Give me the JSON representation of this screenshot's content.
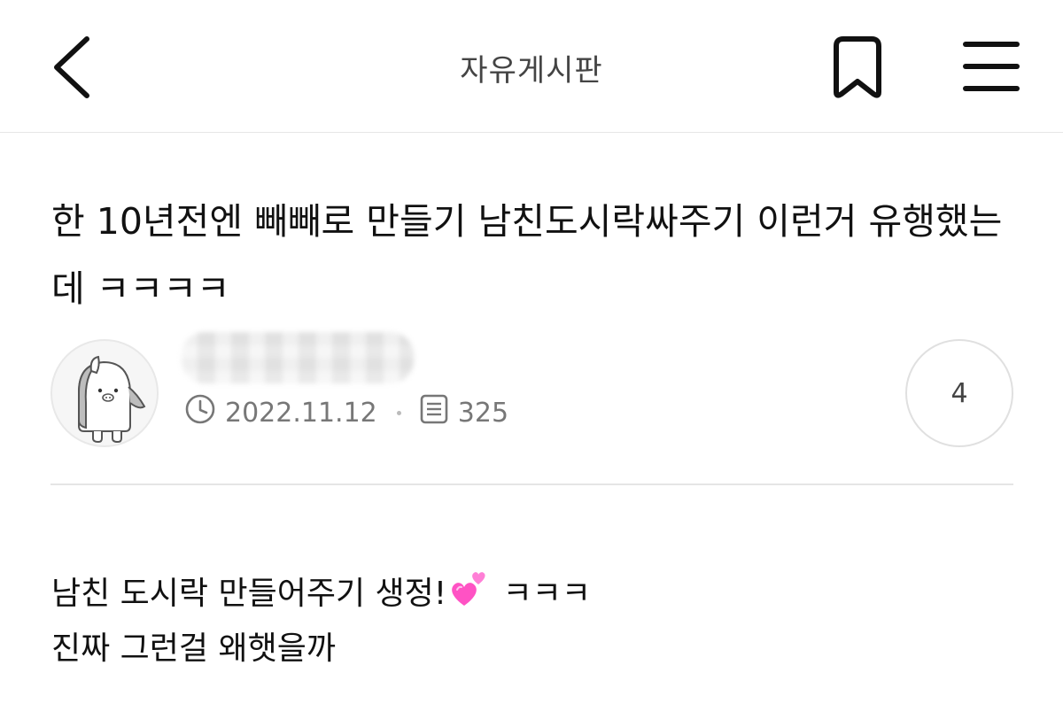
{
  "header": {
    "title": "자유게시판",
    "back_icon": "chevron-left-icon",
    "bookmark_icon": "bookmark-icon",
    "menu_icon": "hamburger-menu-icon"
  },
  "post": {
    "title": "한 10년전엔 빼빼로 만들기 남친도시락싸주기 이런거 유행했는데 ㅋㅋㅋㅋ",
    "author": {
      "name": "",
      "avatar_icon": "bear-mascot-avatar"
    },
    "date": "2022.11.12",
    "views": "325",
    "comment_count": "4",
    "body": {
      "line1_before": "남친 도시락 만들어주기 생정!",
      "line1_emoji": "two-hearts-emoji",
      "line1_after": " ㅋㅋㅋ",
      "line2": "진짜 그런걸 왜햇을까"
    }
  },
  "colors": {
    "text": "#111111",
    "muted": "#777777",
    "border": "#e5e5e5",
    "heart_pink": "#ff4fc1"
  }
}
